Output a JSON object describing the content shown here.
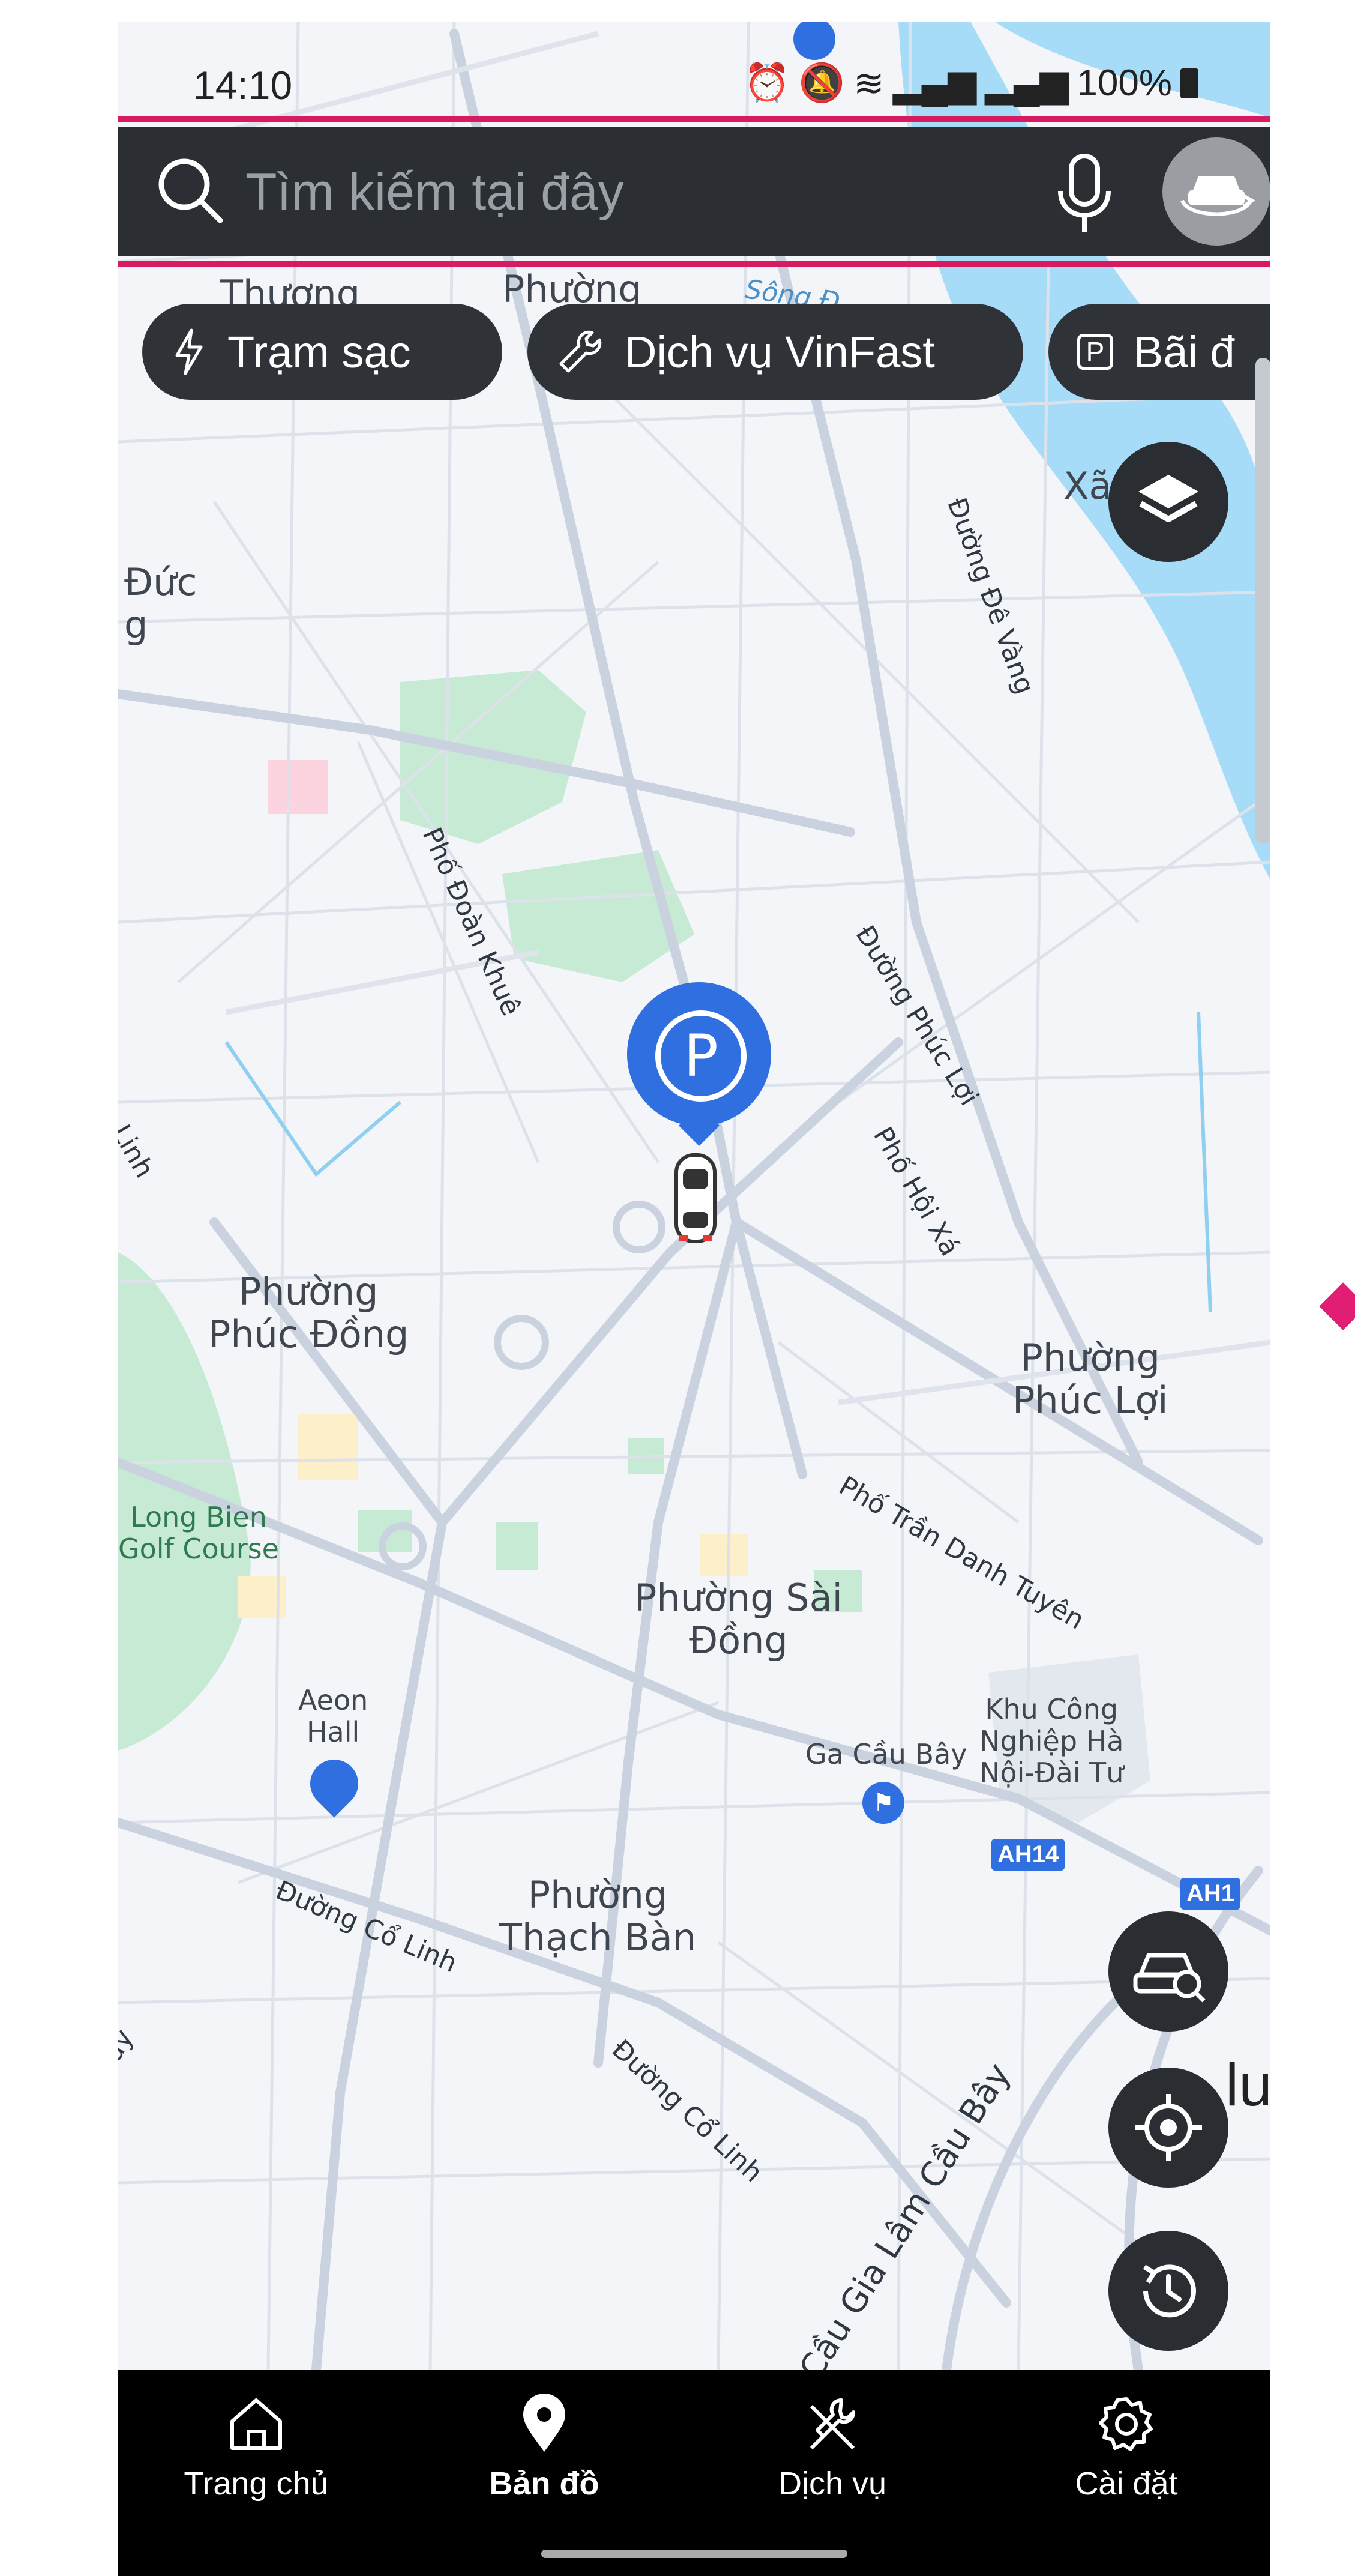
{
  "status": {
    "time": "14:10",
    "battery": "100%"
  },
  "search": {
    "placeholder": "Tìm kiếm tại đây"
  },
  "chips": [
    {
      "label": "Trạm sạc",
      "icon": "lightning-icon"
    },
    {
      "label": "Dịch vụ VinFast",
      "icon": "wrench-icon"
    },
    {
      "label": "Bãi đ",
      "icon": "parking-icon"
    }
  ],
  "map": {
    "areas": [
      {
        "text": "Phường\nPhúc Đồng"
      },
      {
        "text": "Phường\nPhúc Lợi"
      },
      {
        "text": "Phường Sài\nĐồng"
      },
      {
        "text": "Phường\nThạch Bàn"
      },
      {
        "text": "Đức\ng"
      },
      {
        "text": "Thượng"
      },
      {
        "text": "Phường\nGia"
      },
      {
        "text": "Xã"
      }
    ],
    "streets": [
      "Đường Đê Vàng",
      "Phố Đoàn Khuê",
      "Đường Phúc Lợi",
      "Phố Hội Xá",
      "Phố Trần Danh Tuyên",
      "Đường Cổ Linh",
      "Đường Cổ Linh",
      "Cầu Gia Lâm Cầu Bây",
      "Sông Đ",
      "n Linh",
      "luy"
    ],
    "pois": {
      "golf": "Long Bien\nGolf Course",
      "aeon": "Aeon\nHall",
      "station": "Ga Cầu Bây",
      "industrial": "Khu Công\nNghiệp Hà\nNội-Đài Tư",
      "ah14": "AH14",
      "ah1": "AH1",
      "side": "lu"
    },
    "marker_letter": "P"
  },
  "nav": {
    "items": [
      {
        "label": "Trang chủ",
        "icon": "home-icon"
      },
      {
        "label": "Bản đồ",
        "icon": "map-pin-icon"
      },
      {
        "label": "Dịch vụ",
        "icon": "tools-icon"
      },
      {
        "label": "Cài đặt",
        "icon": "gear-icon"
      }
    ],
    "active_index": 1
  },
  "colors": {
    "accent": "#d81b60",
    "marker": "#2f6fe0",
    "panel": "#2b2f33",
    "river": "#a6dcf7",
    "park": "#c6ead3"
  }
}
